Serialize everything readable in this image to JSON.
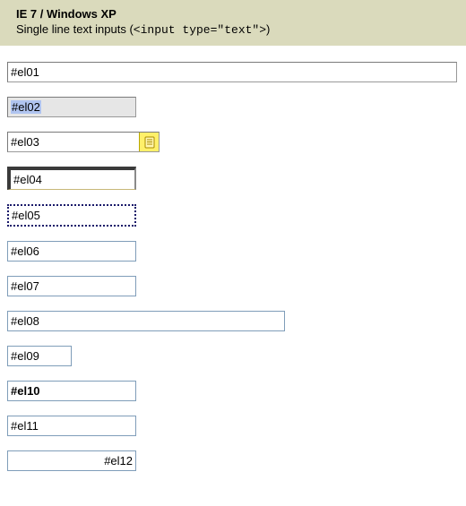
{
  "header": {
    "title": "IE 7 / Windows XP",
    "subtitle_prefix": "Single line text inputs (",
    "subtitle_code": "<input type=\"text\">",
    "subtitle_suffix": ")"
  },
  "inputs": {
    "el01": {
      "value": "#el01"
    },
    "el02": {
      "value": "#el02"
    },
    "el03": {
      "value": "#el03",
      "icon_name": "autofill-icon"
    },
    "el04": {
      "value": "#el04"
    },
    "el05": {
      "value": "#el05"
    },
    "el06": {
      "value": "#el06"
    },
    "el07": {
      "value": "#el07"
    },
    "el08": {
      "value": "#el08"
    },
    "el09": {
      "value": "#el09"
    },
    "el10": {
      "value": "#el10"
    },
    "el11": {
      "value": "#el11"
    },
    "el12": {
      "value": "#el12"
    }
  }
}
